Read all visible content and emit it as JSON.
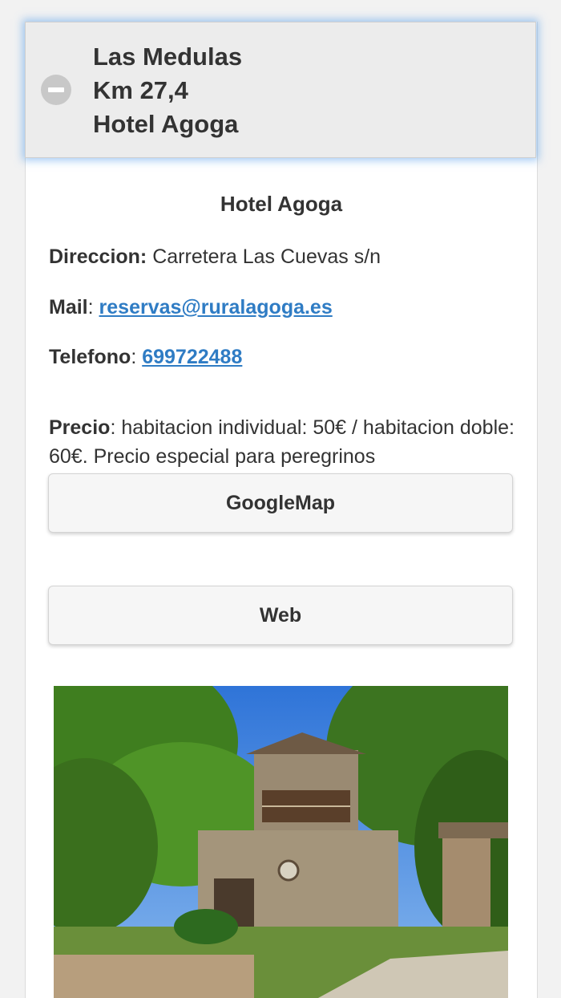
{
  "header": {
    "line1": "Las Medulas",
    "line2": "Km 27,4",
    "line3": "Hotel Agoga",
    "toggle_icon": "minus-circle-icon"
  },
  "detail": {
    "title": "Hotel Agoga",
    "address_label": "Direccion:",
    "address_value": " Carretera Las Cuevas s/n",
    "mail_label": "Mail",
    "mail_value": "reservas@ruralagoga.es",
    "phone_label": "Telefono",
    "phone_value": "699722488",
    "price_label": "Precio",
    "price_value": ": habitacion individual: 50€ / habitacion doble: 60€. Precio especial para peregrinos",
    "colon": ": "
  },
  "buttons": {
    "googlemap": "GoogleMap",
    "web": "Web"
  },
  "colors": {
    "link": "#2f7cc4",
    "header_bg": "#ececec",
    "header_glow": "#5aa0eb"
  }
}
